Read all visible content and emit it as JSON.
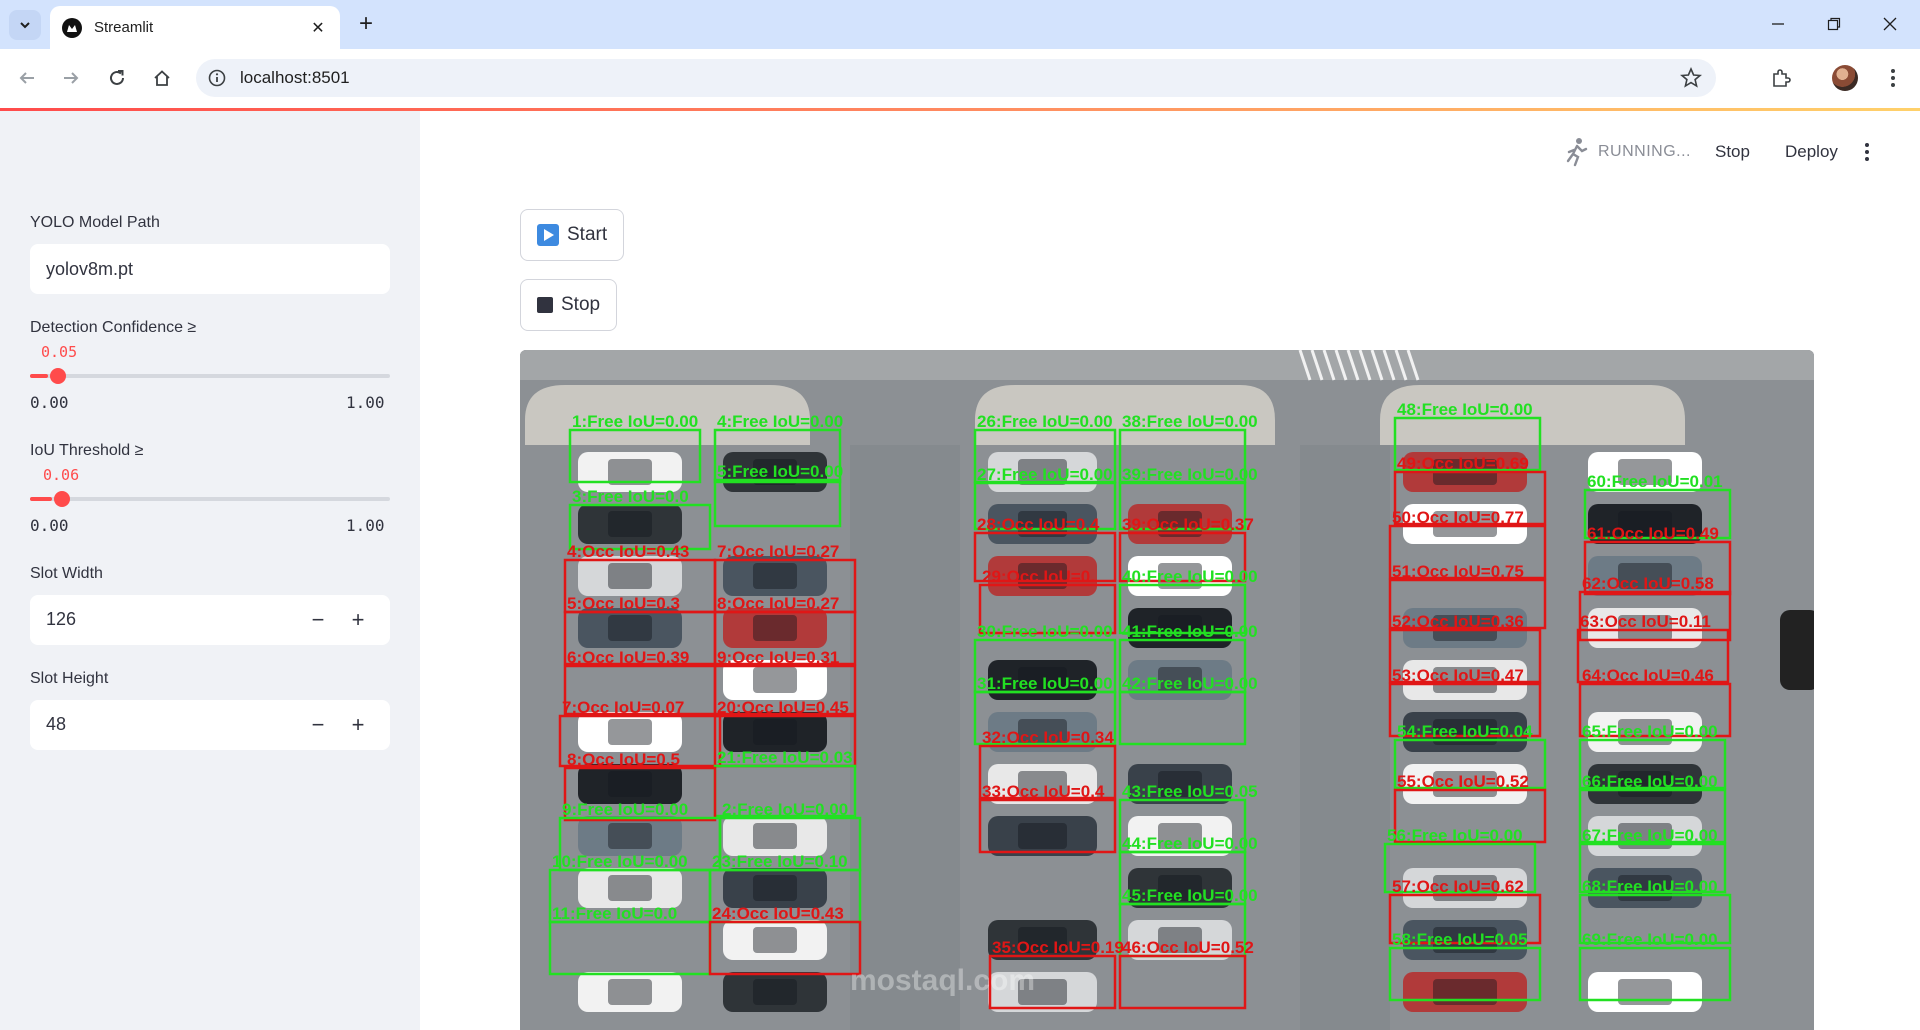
{
  "browser": {
    "tab_title": "Streamlit",
    "url": "localhost:8501"
  },
  "sidebar": {
    "model_path": {
      "label": "YOLO Model Path",
      "value": "yolov8m.pt"
    },
    "confidence": {
      "label": "Detection Confidence ≥",
      "value": "0.05",
      "min": "0.00",
      "max": "1.00",
      "fraction": 0.05
    },
    "iou": {
      "label": "IoU Threshold ≥",
      "value": "0.06",
      "min": "0.00",
      "max": "1.00",
      "fraction": 0.06
    },
    "slot_width": {
      "label": "Slot Width",
      "value": "126",
      "minus": "−",
      "plus": "+"
    },
    "slot_height": {
      "label": "Slot Height",
      "value": "48",
      "minus": "−",
      "plus": "+"
    }
  },
  "header": {
    "status": "RUNNING...",
    "stop": "Stop",
    "deploy": "Deploy"
  },
  "main": {
    "start_button": "Start",
    "stop_button": "Stop"
  },
  "colors": {
    "accent": "#ff4b4b",
    "free": "#22e022",
    "occupied": "#e01616"
  },
  "video": {
    "watermark": "mostaql.com",
    "slots": [
      {
        "label": "1:Free IoU=0.00",
        "status": "free"
      },
      {
        "label": "4:Free IoU=0.00",
        "status": "free"
      },
      {
        "label": "5:Free IoU=0.00",
        "status": "free"
      },
      {
        "label": "3:Free IoU=0.0",
        "status": "free"
      },
      {
        "label": "4:Occ IoU=0.43",
        "status": "occ"
      },
      {
        "label": "7:Occ IoU=0.27",
        "status": "occ"
      },
      {
        "label": "5:Occ IoU=0.3",
        "status": "occ"
      },
      {
        "label": "8:Occ IoU=0.27",
        "status": "occ"
      },
      {
        "label": "6:Occ IoU=0.39",
        "status": "occ"
      },
      {
        "label": "9:Occ IoU=0.31",
        "status": "occ"
      },
      {
        "label": "7:Occ IoU=0.07",
        "status": "occ"
      },
      {
        "label": "20:Occ IoU=0.45",
        "status": "occ"
      },
      {
        "label": "21:Free IoU=0.03",
        "status": "free"
      },
      {
        "label": "8:Occ IoU=0.5",
        "status": "occ"
      },
      {
        "label": "9:Free IoU=0.00",
        "status": "free"
      },
      {
        "label": "2:Free IoU=0.00",
        "status": "free"
      },
      {
        "label": "10:Free IoU=0.00",
        "status": "free"
      },
      {
        "label": "23:Free IoU=0.10",
        "status": "free"
      },
      {
        "label": "11:Free IoU=0.0",
        "status": "free"
      },
      {
        "label": "24:Occ IoU=0.43",
        "status": "occ"
      },
      {
        "label": "26:Free IoU=0.00",
        "status": "free"
      },
      {
        "label": "38:Free IoU=0.00",
        "status": "free"
      },
      {
        "label": "27:Free IoU=0.00",
        "status": "free"
      },
      {
        "label": "39:Free IoU=0.00",
        "status": "free"
      },
      {
        "label": "28:Occ IoU=0.4",
        "status": "occ"
      },
      {
        "label": "39:Occ IoU=0.37",
        "status": "occ"
      },
      {
        "label": "29:Occ IoU=0.",
        "status": "occ"
      },
      {
        "label": "40:Free IoU=0.00",
        "status": "free"
      },
      {
        "label": "30:Free IoU=0.00",
        "status": "free"
      },
      {
        "label": "41:Free IoU=0.00",
        "status": "free"
      },
      {
        "label": "31:Free IoU=0.00",
        "status": "free"
      },
      {
        "label": "42:Free IoU=0.00",
        "status": "free"
      },
      {
        "label": "32:Occ IoU=0.34",
        "status": "occ"
      },
      {
        "label": "33:Occ IoU=0.4",
        "status": "occ"
      },
      {
        "label": "43:Free IoU=0.05",
        "status": "free"
      },
      {
        "label": "44:Free IoU=0.00",
        "status": "free"
      },
      {
        "label": "45:Free IoU=0.00",
        "status": "free"
      },
      {
        "label": "35:Occ IoU=0.19",
        "status": "occ"
      },
      {
        "label": "46:Occ IoU=0.52",
        "status": "occ"
      },
      {
        "label": "48:Free IoU=0.00",
        "status": "free"
      },
      {
        "label": "49:Occ IoU=0.69",
        "status": "occ"
      },
      {
        "label": "60:Free IoU=0.01",
        "status": "free"
      },
      {
        "label": "50:Occ IoU=0.77",
        "status": "occ"
      },
      {
        "label": "61:Occ IoU=0.49",
        "status": "occ"
      },
      {
        "label": "51:Occ IoU=0.75",
        "status": "occ"
      },
      {
        "label": "62:Occ IoU=0.58",
        "status": "occ"
      },
      {
        "label": "52:Occ IoU=0.36",
        "status": "occ"
      },
      {
        "label": "63:Occ IoU=0.11",
        "status": "occ"
      },
      {
        "label": "53:Occ IoU=0.47",
        "status": "occ"
      },
      {
        "label": "64:Occ IoU=0.46",
        "status": "occ"
      },
      {
        "label": "54:Free IoU=0.04",
        "status": "free"
      },
      {
        "label": "65:Free IoU=0.00",
        "status": "free"
      },
      {
        "label": "55:Occ IoU=0.52",
        "status": "occ"
      },
      {
        "label": "66:Free IoU=0.00",
        "status": "free"
      },
      {
        "label": "56:Free IoU=0.00",
        "status": "free"
      },
      {
        "label": "67:Free IoU=0.00",
        "status": "free"
      },
      {
        "label": "57:Occ IoU=0.62",
        "status": "occ"
      },
      {
        "label": "68:Free IoU=0.00",
        "status": "free"
      },
      {
        "label": "58:Free IoU=0.05",
        "status": "free"
      },
      {
        "label": "69:Free IoU=0.00",
        "status": "free"
      }
    ]
  }
}
